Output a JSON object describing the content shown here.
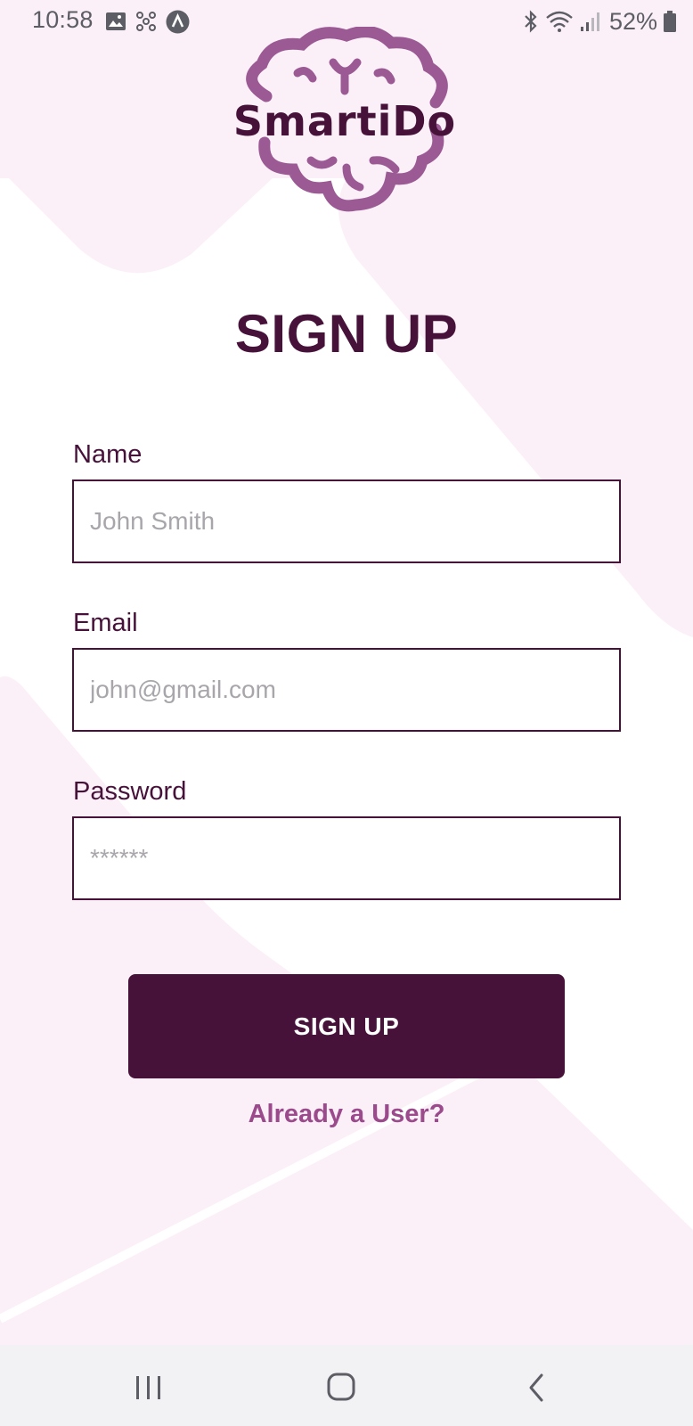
{
  "status_bar": {
    "time": "10:58",
    "battery_text": "52%",
    "left_icons": [
      "image-icon",
      "pinwheel-icon",
      "app-a-icon"
    ],
    "right_icons": [
      "bluetooth-icon",
      "wifi-icon",
      "signal-icon",
      "battery-icon"
    ]
  },
  "logo": {
    "text": "SmartiDo",
    "color": "#9b5a94",
    "text_color": "#47123a"
  },
  "page": {
    "title": "SIGN UP"
  },
  "form": {
    "name": {
      "label": "Name",
      "placeholder": "John Smith",
      "value": ""
    },
    "email": {
      "label": "Email",
      "placeholder": "john@gmail.com",
      "value": ""
    },
    "password": {
      "label": "Password",
      "placeholder": "******",
      "value": ""
    }
  },
  "actions": {
    "signup_label": "SIGN UP",
    "login_link": "Already a User?"
  },
  "nav_bar": {
    "icons": [
      "recent-apps-icon",
      "home-icon",
      "back-icon"
    ]
  },
  "colors": {
    "primary": "#47123a",
    "accent": "#9b4a8c",
    "background_tint": "#fbf0f8",
    "placeholder": "#a9a6ab"
  }
}
